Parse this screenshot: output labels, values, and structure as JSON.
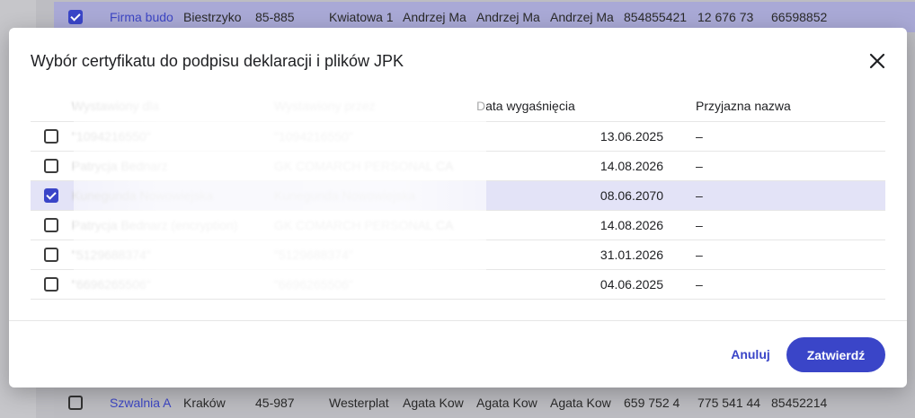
{
  "background_table": {
    "top_row": [
      "Firma budo",
      "Biestrzyko",
      "85-885",
      "Kwiatowa 1",
      "Andrzej Ma",
      "Andrzej Ma",
      "Andrzej Ma",
      "854855421",
      "12 676 73",
      "66598852"
    ],
    "bottom_row": [
      "Szwalnia A",
      "Kraków",
      "45-987",
      "Westerplat",
      "Agata Kow",
      "Agata Kow",
      "Agata Kow",
      "659 752 4",
      "775 541 44",
      "85452214"
    ]
  },
  "modal": {
    "title": "Wybór certyfikatu do podpisu deklaracji i plików JPK",
    "columns": {
      "issued_to": "Wystawiony dla",
      "issued_by": "Wystawiony przez",
      "expiry": "Data wygaśnięcia",
      "friendly_name": "Przyjazna nazwa"
    },
    "rows": [
      {
        "issued_to": "\"1094216550\"",
        "issued_by": "\"1094216550\"",
        "expiry": "13.06.2025",
        "friendly_name": "–",
        "checked": false
      },
      {
        "issued_to": "Patrycja Bednarz",
        "issued_by": "GK COMARCH PERSONAL CA",
        "expiry": "14.08.2026",
        "friendly_name": "–",
        "checked": false
      },
      {
        "issued_to": "Kunegunda Nowowiejska",
        "issued_by": "Kunegunda Nowowiejska",
        "expiry": "08.06.2070",
        "friendly_name": "–",
        "checked": true
      },
      {
        "issued_to": "Patrycja Bednarz (encryption)",
        "issued_by": "GK COMARCH PERSONAL CA",
        "expiry": "14.08.2026",
        "friendly_name": "–",
        "checked": false
      },
      {
        "issued_to": "\"5129688374\"",
        "issued_by": "\"5129688374\"",
        "expiry": "31.01.2026",
        "friendly_name": "–",
        "checked": false
      },
      {
        "issued_to": "\"6696265506\"",
        "issued_by": "\"6696265506\"",
        "expiry": "04.06.2025",
        "friendly_name": "–",
        "checked": false
      }
    ],
    "cancel_label": "Anuluj",
    "confirm_label": "Zatwierdź"
  },
  "colors": {
    "accent": "#3a45c8",
    "selected_row": "#e3e3f7"
  }
}
